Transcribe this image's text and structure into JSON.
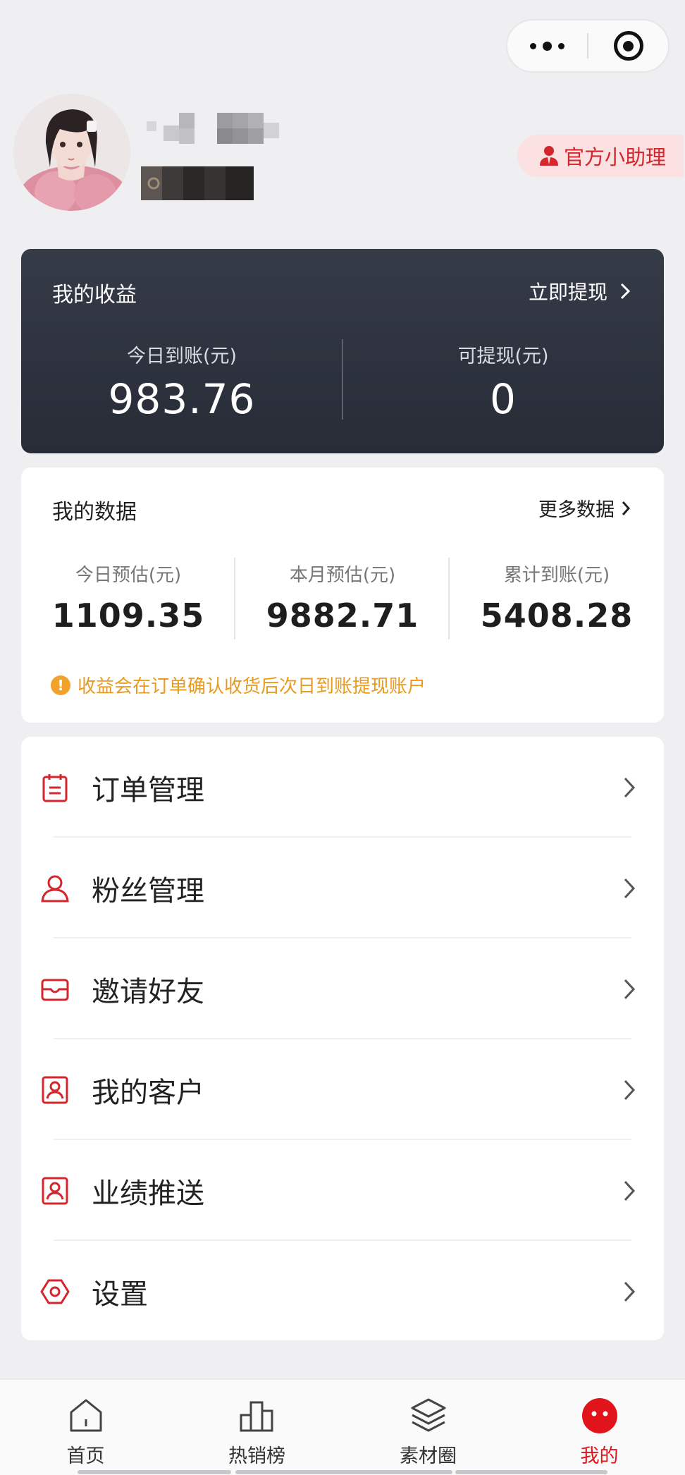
{
  "capsule": {
    "more_icon": "more-dots-icon",
    "close_icon": "target-close-icon"
  },
  "profile": {
    "assistant_label": "官方小助理",
    "assistant_icon": "assistant-person-icon"
  },
  "earnings": {
    "title": "我的收益",
    "withdraw_link": "立即提现",
    "today_label": "今日到账(元)",
    "today_value": "983.76",
    "withdrawable_label": "可提现(元)",
    "withdrawable_value": "0"
  },
  "my_data": {
    "title": "我的数据",
    "more_link": "更多数据",
    "stats": [
      {
        "label": "今日预估(元)",
        "value": "1109.35"
      },
      {
        "label": "本月预估(元)",
        "value": "9882.71"
      },
      {
        "label": "累计到账(元)",
        "value": "5408.28"
      }
    ],
    "notice": "收益会在订单确认收货后次日到账提现账户"
  },
  "menu": {
    "items": [
      {
        "label": "订单管理",
        "icon": "order-clipboard-icon"
      },
      {
        "label": "粉丝管理",
        "icon": "fans-person-icon"
      },
      {
        "label": "邀请好友",
        "icon": "invite-envelope-icon"
      },
      {
        "label": "我的客户",
        "icon": "customer-card-icon"
      },
      {
        "label": "业绩推送",
        "icon": "performance-card-icon"
      },
      {
        "label": "设置",
        "icon": "settings-hexagon-icon"
      }
    ]
  },
  "tabbar": {
    "tabs": [
      {
        "label": "首页",
        "icon": "home-icon"
      },
      {
        "label": "热销榜",
        "icon": "bar-chart-icon"
      },
      {
        "label": "素材圈",
        "icon": "layers-icon"
      },
      {
        "label": "我的",
        "icon": "mine-face-icon"
      }
    ],
    "active_color": "#e0141a"
  },
  "colors": {
    "accent": "#d4262c",
    "card_dark": "#2d323d",
    "notice": "#e99a20"
  }
}
